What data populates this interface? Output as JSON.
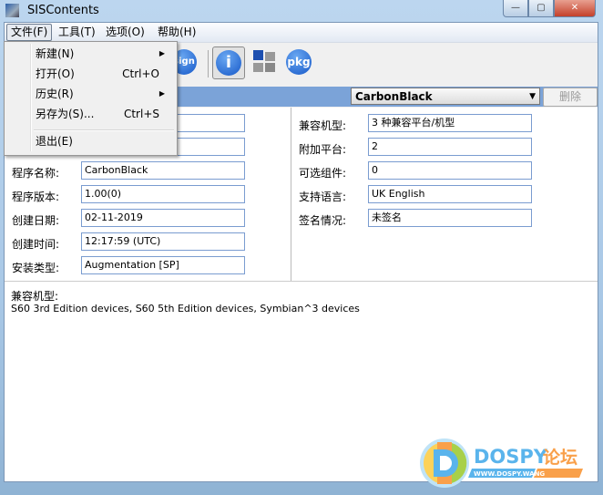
{
  "window": {
    "title": "SISContents"
  },
  "menubar": [
    {
      "label": "文件(F)"
    },
    {
      "label": "工具(T)"
    },
    {
      "label": "选项(O)"
    },
    {
      "label": "帮助(H)"
    }
  ],
  "file_menu": [
    {
      "label": "新建(N)",
      "shortcut": "",
      "submenu": true
    },
    {
      "label": "打开(O)",
      "shortcut": "Ctrl+O",
      "submenu": false
    },
    {
      "label": "历史(R)",
      "shortcut": "",
      "submenu": true
    },
    {
      "label": "另存为(S)...",
      "shortcut": "Ctrl+S",
      "submenu": false
    },
    {
      "label": "退出(E)",
      "shortcut": "",
      "submenu": false
    }
  ],
  "toolbar": {
    "sign": "sign",
    "info": "i",
    "pkg": "pkg"
  },
  "selector": {
    "value": "CarbonBlack",
    "delete_label": "删除"
  },
  "left_fields": [
    {
      "label": "",
      "value": ""
    },
    {
      "label": "",
      "value": ""
    },
    {
      "label": "程序名称:",
      "value": "CarbonBlack"
    },
    {
      "label": "程序版本:",
      "value": "1.00(0)"
    },
    {
      "label": "创建日期:",
      "value": "02-11-2019"
    },
    {
      "label": "创建时间:",
      "value": "12:17:59 (UTC)"
    },
    {
      "label": "安装类型:",
      "value": "Augmentation [SP]"
    }
  ],
  "right_fields": [
    {
      "label": "兼容机型:",
      "value": "3 种兼容平台/机型"
    },
    {
      "label": "附加平台:",
      "value": "2"
    },
    {
      "label": "可选组件:",
      "value": "0"
    },
    {
      "label": "支持语言:",
      "value": "UK English"
    },
    {
      "label": "签名情况:",
      "value": "未签名"
    }
  ],
  "compat": {
    "label": "兼容机型:",
    "text": "S60 3rd Edition devices, S60 5th Edition devices, Symbian^3 devices"
  },
  "watermark": {
    "text": "DOSPY论坛",
    "url": "WWW.DOSPY.WANG"
  }
}
